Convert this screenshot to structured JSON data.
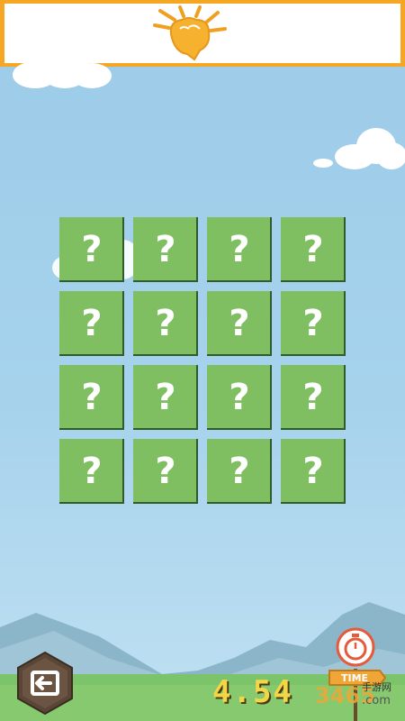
{
  "header": {
    "logo": "fist-logo"
  },
  "board": {
    "rows": 4,
    "cols": 4,
    "cards": [
      "?",
      "?",
      "?",
      "?",
      "?",
      "?",
      "?",
      "?",
      "?",
      "?",
      "?",
      "?",
      "?",
      "?",
      "?",
      "?"
    ]
  },
  "hud": {
    "timer": "4.54",
    "time_label": "TIME",
    "back_icon": "back-icon",
    "stopwatch_icon": "stopwatch-icon"
  },
  "watermark": {
    "number": "3465",
    "cn": "手游网",
    "domain": ".com"
  },
  "colors": {
    "banner": "#f5a623",
    "card": "#7fbf62",
    "sky": "#9ccbe8",
    "timer": "#f2d648"
  }
}
